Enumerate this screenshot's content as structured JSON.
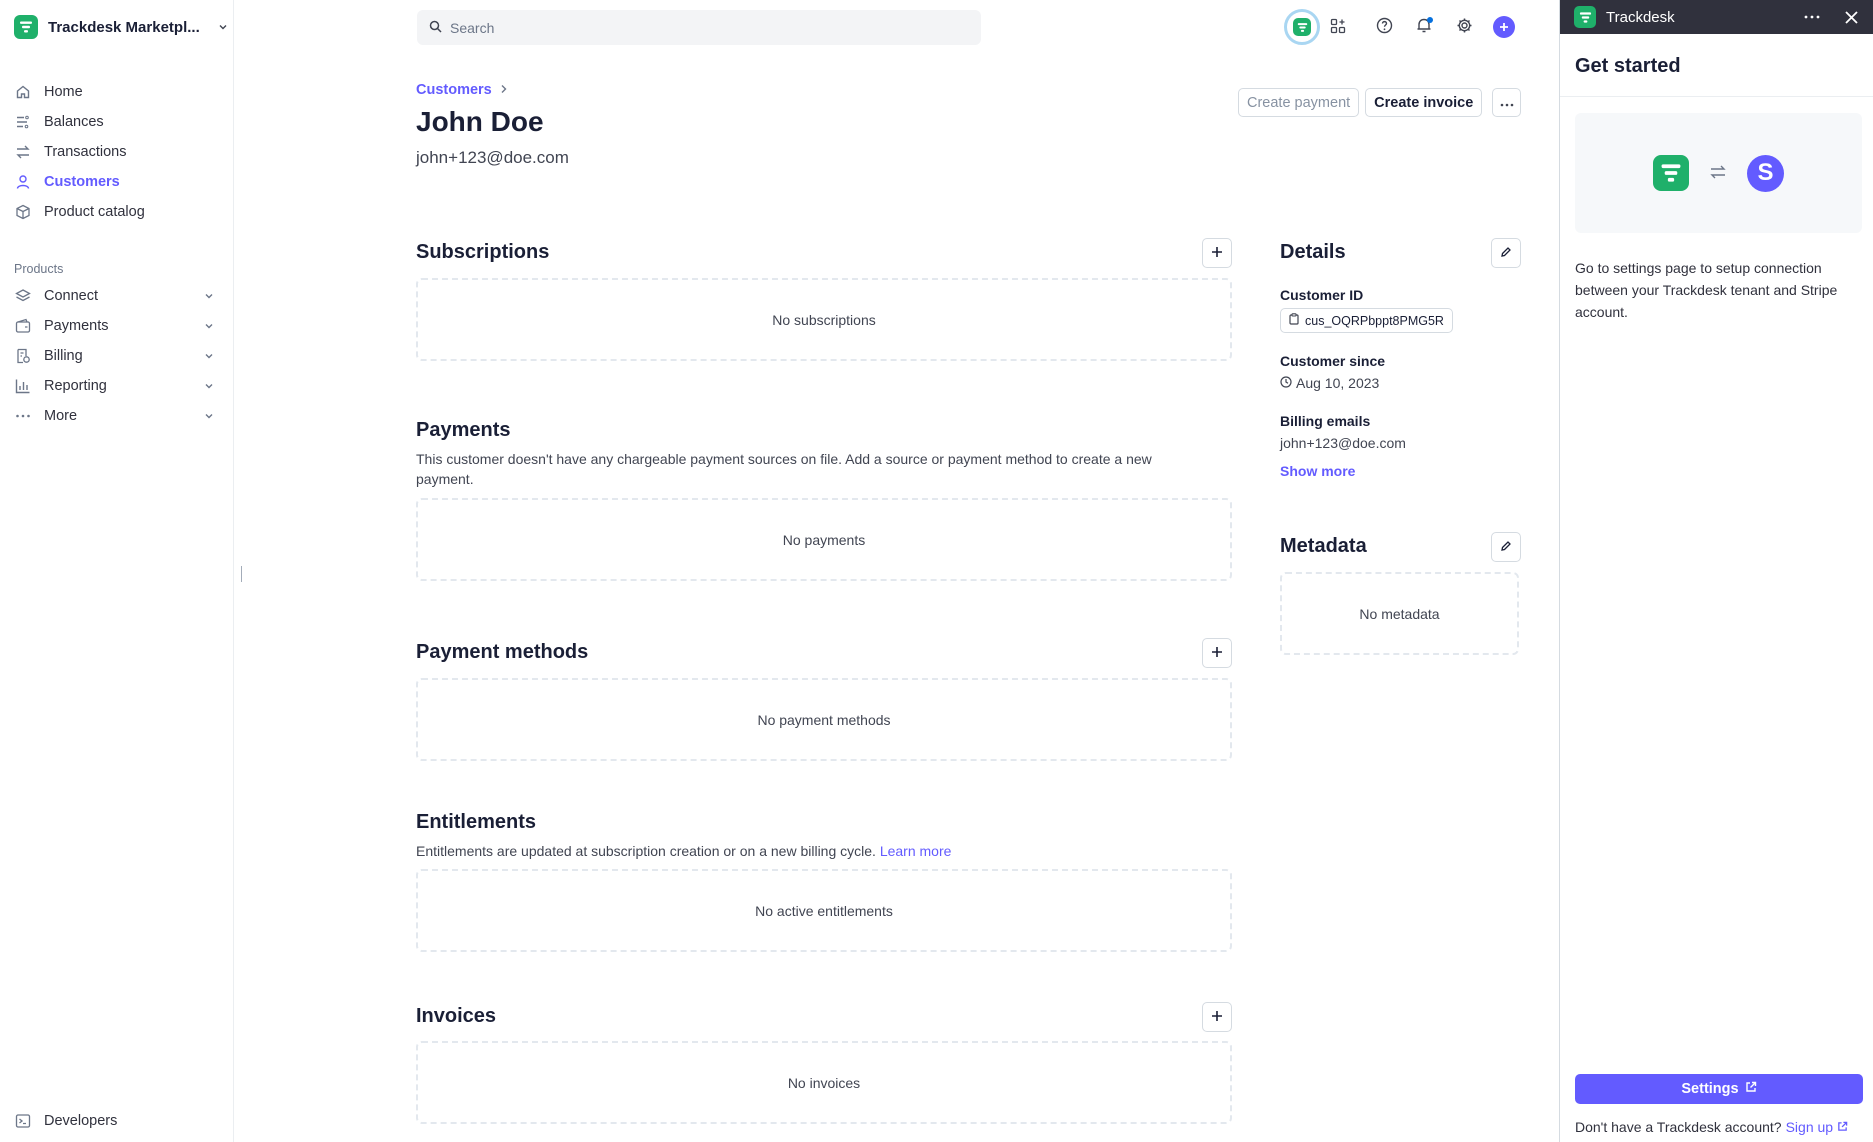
{
  "brand": {
    "name": "Trackdesk Marketpl...",
    "color": "#1fb06a"
  },
  "sidebar": {
    "items": [
      {
        "label": "Home",
        "icon": "home-icon"
      },
      {
        "label": "Balances",
        "icon": "balances-icon"
      },
      {
        "label": "Transactions",
        "icon": "transactions-icon"
      },
      {
        "label": "Customers",
        "icon": "person-icon",
        "active": true
      },
      {
        "label": "Product catalog",
        "icon": "box-icon"
      }
    ],
    "section_label": "Products",
    "products": [
      {
        "label": "Connect",
        "icon": "layers-icon"
      },
      {
        "label": "Payments",
        "icon": "wallet-icon"
      },
      {
        "label": "Billing",
        "icon": "billing-icon"
      },
      {
        "label": "Reporting",
        "icon": "bar-chart-icon"
      },
      {
        "label": "More",
        "icon": "dots-icon"
      }
    ],
    "developers": "Developers"
  },
  "search": {
    "placeholder": "Search"
  },
  "accent": "#635bff",
  "header": {
    "breadcrumb": "Customers",
    "title": "John Doe",
    "email": "john+123@doe.com",
    "create_payment": "Create payment",
    "create_invoice": "Create invoice"
  },
  "sections": {
    "subscriptions": {
      "title": "Subscriptions",
      "empty": "No subscriptions"
    },
    "payments": {
      "title": "Payments",
      "desc": "This customer doesn't have any chargeable payment sources on file. Add a source or payment method to create a new payment.",
      "empty": "No payments"
    },
    "payment_methods": {
      "title": "Payment methods",
      "empty": "No payment methods"
    },
    "entitlements": {
      "title": "Entitlements",
      "desc": "Entitlements are updated at subscription creation or on a new billing cycle.",
      "link": "Learn more",
      "empty": "No active entitlements"
    },
    "invoices": {
      "title": "Invoices",
      "empty": "No invoices"
    }
  },
  "details": {
    "title": "Details",
    "customer_id_label": "Customer ID",
    "customer_id": "cus_OQRPbppt8PMG5R",
    "customer_since_label": "Customer since",
    "customer_since": "Aug 10, 2023",
    "billing_emails_label": "Billing emails",
    "billing_email": "john+123@doe.com",
    "show_more": "Show more"
  },
  "metadata": {
    "title": "Metadata",
    "empty": "No metadata"
  },
  "panel": {
    "app_name": "Trackdesk",
    "title": "Get started",
    "text": "Go to settings page to setup connection between your Trackdesk tenant and Stripe account.",
    "stripe_letter": "S",
    "settings_label": "Settings",
    "signup_text": "Don't have a Trackdesk account?",
    "signup_link": "Sign up"
  }
}
